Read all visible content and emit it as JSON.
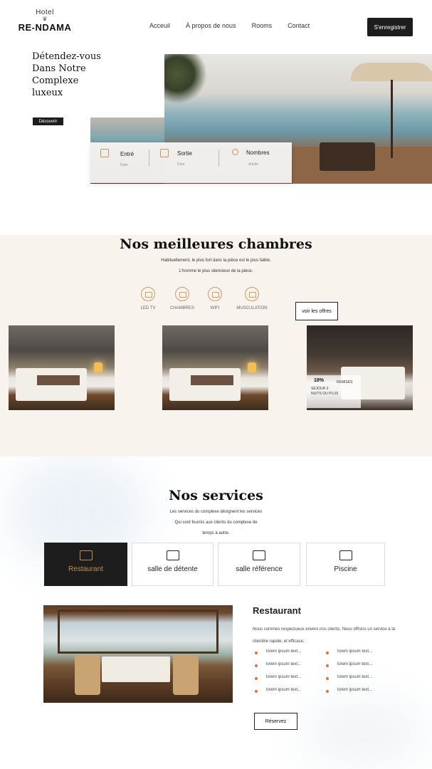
{
  "header": {
    "logo_top": "Hotel",
    "logo_name": "RE-NDAMA",
    "nav": [
      "Acceuil",
      "À propos de nous",
      "Rooms",
      "Contact"
    ],
    "register_label": "S'enregistrer"
  },
  "hero": {
    "title_lines": [
      "Détendez-vous",
      "Dans Notre",
      "Complexe",
      "luxeux"
    ],
    "cta_label": "Découvrir",
    "booking": [
      {
        "label": "Entré",
        "value": "Date",
        "icon": "calendar-icon"
      },
      {
        "label": "Sortie",
        "value": "Date",
        "icon": "calendar-icon"
      },
      {
        "label": "Nombres",
        "value": "Adulte",
        "icon": "user-icon"
      }
    ]
  },
  "rooms": {
    "title": "Nos meilleures chambres",
    "subtitle_lines": [
      "Habituellement,  le plus fort dans la pièce est le plus faible.",
      "L'homme le plus silencieux de la pièce."
    ],
    "features": [
      {
        "label": "LED TV",
        "icon": "tv-icon"
      },
      {
        "label": "CHAMBRES",
        "icon": "bed-icon"
      },
      {
        "label": "WIFI",
        "icon": "wifi-icon"
      },
      {
        "label": "MUSCULATION",
        "icon": "dumbbell-icon"
      }
    ],
    "offers_label": "voir les offres",
    "promo": {
      "percent": "18%",
      "label": "REMISES",
      "detail": "SÉJOUR 3 NUITS OU PLUS"
    }
  },
  "services": {
    "title": "Nos services",
    "subtitle_lines": [
      "Les services du complexe désignent les services",
      "Qui sont fournis aux clients du complexe de",
      "temps à autre."
    ],
    "tabs": [
      {
        "label": "Restaurant",
        "icon": "restaurant-icon",
        "active": true
      },
      {
        "label": "salle de détente",
        "icon": "bed-icon",
        "active": false
      },
      {
        "label": "salle référence",
        "icon": "presentation-icon",
        "active": false
      },
      {
        "label": "Piscine",
        "icon": "pool-icon",
        "active": false
      }
    ],
    "detail": {
      "title": "Restaurant",
      "text": "Nous sommes respectueux envers nos clients. Nous offrons un service  à la clientèle rapide, et efficace.",
      "list_left": [
        "lorem ipsum text...",
        "lorem ipsum text...",
        "lorem ipsum text...",
        "lorem ipsum text..."
      ],
      "list_right": [
        "lorem ipsum text...",
        "lorem ipsum text...",
        "lorem ipsum text...",
        "lorem ipsum text..."
      ],
      "button_label": "Réservez"
    }
  },
  "colors": {
    "accent": "#c88d55",
    "dark": "#1d1d1d",
    "section_bg": "#f9f3ee",
    "bullet": "#d9743d"
  }
}
